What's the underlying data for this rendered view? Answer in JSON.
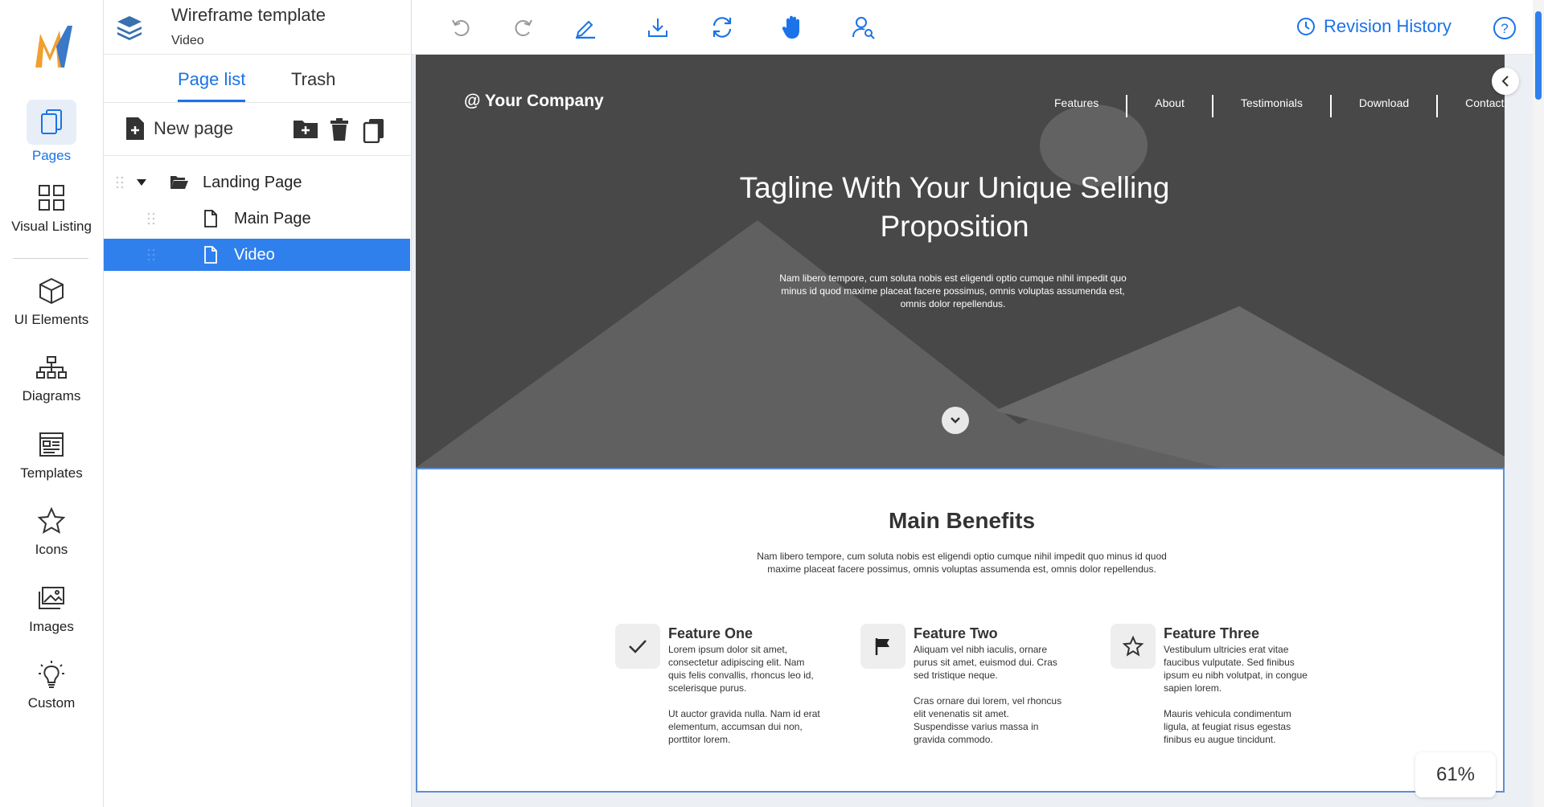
{
  "rail": {
    "items": [
      {
        "label": "Pages",
        "icon": "pages-icon"
      },
      {
        "label": "Visual Listing",
        "icon": "grid-icon"
      },
      {
        "label": "UI Elements",
        "icon": "cube-icon"
      },
      {
        "label": "Diagrams",
        "icon": "sitemap-icon"
      },
      {
        "label": "Templates",
        "icon": "template-icon"
      },
      {
        "label": "Icons",
        "icon": "star-icon"
      },
      {
        "label": "Images",
        "icon": "images-icon"
      },
      {
        "label": "Custom",
        "icon": "lightbulb-icon"
      }
    ]
  },
  "panel": {
    "project_title": "Wireframe template",
    "project_subtitle": "Video",
    "tabs": [
      {
        "label": "Page list"
      },
      {
        "label": "Trash"
      }
    ],
    "new_page_label": "New page",
    "tree": [
      {
        "label": "Landing Page",
        "type": "folder",
        "expanded": true
      },
      {
        "label": "Main Page",
        "type": "page"
      },
      {
        "label": "Video",
        "type": "page",
        "selected": true
      }
    ]
  },
  "toolbar": {
    "revision_history_label": "Revision History"
  },
  "canvas": {
    "brand": "@ Your Company",
    "nav": [
      "Features",
      "About",
      "Testimonials",
      "Download",
      "Contact"
    ],
    "tagline": "Tagline With Your Unique Selling Proposition",
    "hero_text": "Nam libero tempore, cum soluta nobis est eligendi optio cumque nihil impedit quo minus id quod maxime placeat facere possimus, omnis voluptas assumenda est, omnis dolor repellendus.",
    "benefits_title": "Main Benefits",
    "benefits_text": "Nam libero tempore, cum soluta nobis est eligendi optio cumque nihil impedit quo minus id quod maxime placeat facere possimus, omnis voluptas assumenda est, omnis dolor repellendus.",
    "features": [
      {
        "title": "Feature One",
        "icon": "check-icon",
        "p1": "Lorem ipsum dolor sit amet, consectetur adipiscing elit. Nam quis felis convallis, rhoncus leo id, scelerisque purus.",
        "p2": "Ut auctor gravida nulla. Nam id erat elementum, accumsan dui non, porttitor lorem."
      },
      {
        "title": "Feature Two",
        "icon": "flag-icon",
        "p1": "Aliquam vel nibh iaculis, ornare purus sit amet, euismod dui. Cras sed tristique neque.",
        "p2": "Cras ornare dui lorem, vel rhoncus elit venenatis sit amet. Suspendisse varius massa in gravida commodo."
      },
      {
        "title": "Feature Three",
        "icon": "star-outline-icon",
        "p1": "Vestibulum ultricies erat vitae faucibus vulputate. Sed finibus ipsum eu nibh volutpat, in congue sapien lorem.",
        "p2": "Mauris vehicula condimentum ligula, at feugiat risus egestas finibus eu augue tincidunt."
      }
    ]
  },
  "zoom_level": "61%",
  "colors": {
    "accent": "#1a73e8",
    "selected_row": "#2f80ed",
    "hero_bg": "#484848",
    "logo_orange": "#f0a030",
    "logo_blue": "#3a78c8"
  }
}
